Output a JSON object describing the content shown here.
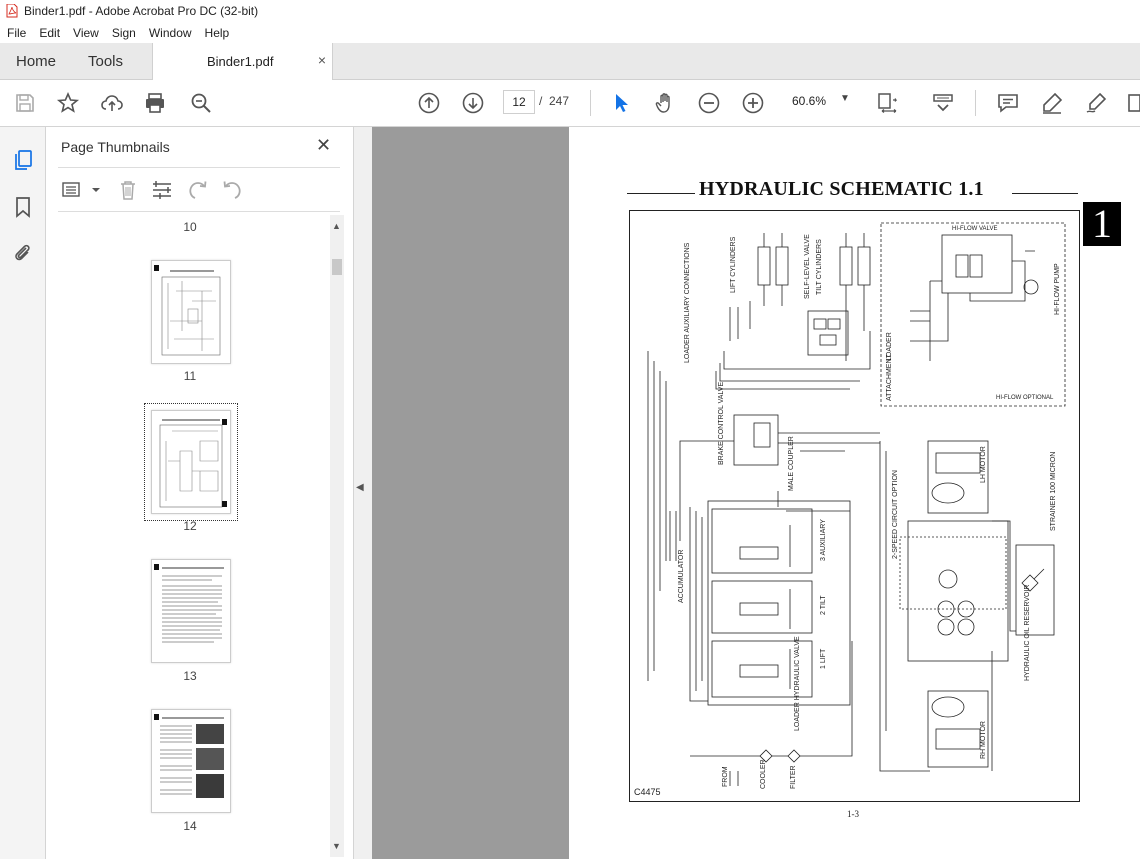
{
  "window": {
    "title": "Binder1.pdf - Adobe Acrobat Pro DC (32-bit)"
  },
  "menu": [
    "File",
    "Edit",
    "View",
    "Sign",
    "Window",
    "Help"
  ],
  "tabs": {
    "home": "Home",
    "tools": "Tools",
    "document": "Binder1.pdf",
    "close": "×"
  },
  "toolbar": {
    "page_current": "12",
    "page_sep": "/",
    "page_total": "247",
    "zoom": "60.6%"
  },
  "thumbnails": {
    "title": "Page Thumbnails",
    "close": "✕",
    "pages": [
      {
        "label": "10"
      },
      {
        "label": "11"
      },
      {
        "label": "12",
        "selected": true
      },
      {
        "label": "13"
      },
      {
        "label": "14"
      }
    ]
  },
  "document": {
    "heading": "HYDRAULIC SCHEMATIC 1.1",
    "section_number": "1",
    "figure_code": "C4475",
    "page_label": "1-3",
    "schematic_labels": {
      "loader_aux": "LOADER AUXILIARY CONNECTIONS",
      "lift_cyl": "LIFT CYLINDERS",
      "tilt_cyl": "TILT CYLINDERS",
      "self_level": "SELF-LEVEL VALVE",
      "hiflow_valve": "HI-FLOW VALVE",
      "hiflow_pump": "HI-FLOW PUMP",
      "hiflow_optional": "HI-FLOW OPTIONAL",
      "brake_valve": "BRAKE CONTROL VALVE",
      "male_coupler": "MALE COUPLER",
      "accumulator": "ACCUMULATOR",
      "aux3": "3 AUXILIARY",
      "tilt2": "2 TILT",
      "lift1": "1 LIFT",
      "loader_valve": "LOADER HYDRAULIC VALVE",
      "lh_motor": "LH MOTOR",
      "rh_motor": "RH MOTOR",
      "strainer": "STRAINER 100 MICRON",
      "reservoir": "HYDRAULIC OIL RESERVOIR",
      "cooler": "COOLER",
      "filter": "FILTER",
      "from": "FROM",
      "two_speed": "2-SPEED CIRCUIT OPTION",
      "attachment": "ATTACHMENT",
      "loader": "LOADER"
    }
  },
  "colors": {
    "accent": "#1473e6",
    "badge": "#000000"
  }
}
